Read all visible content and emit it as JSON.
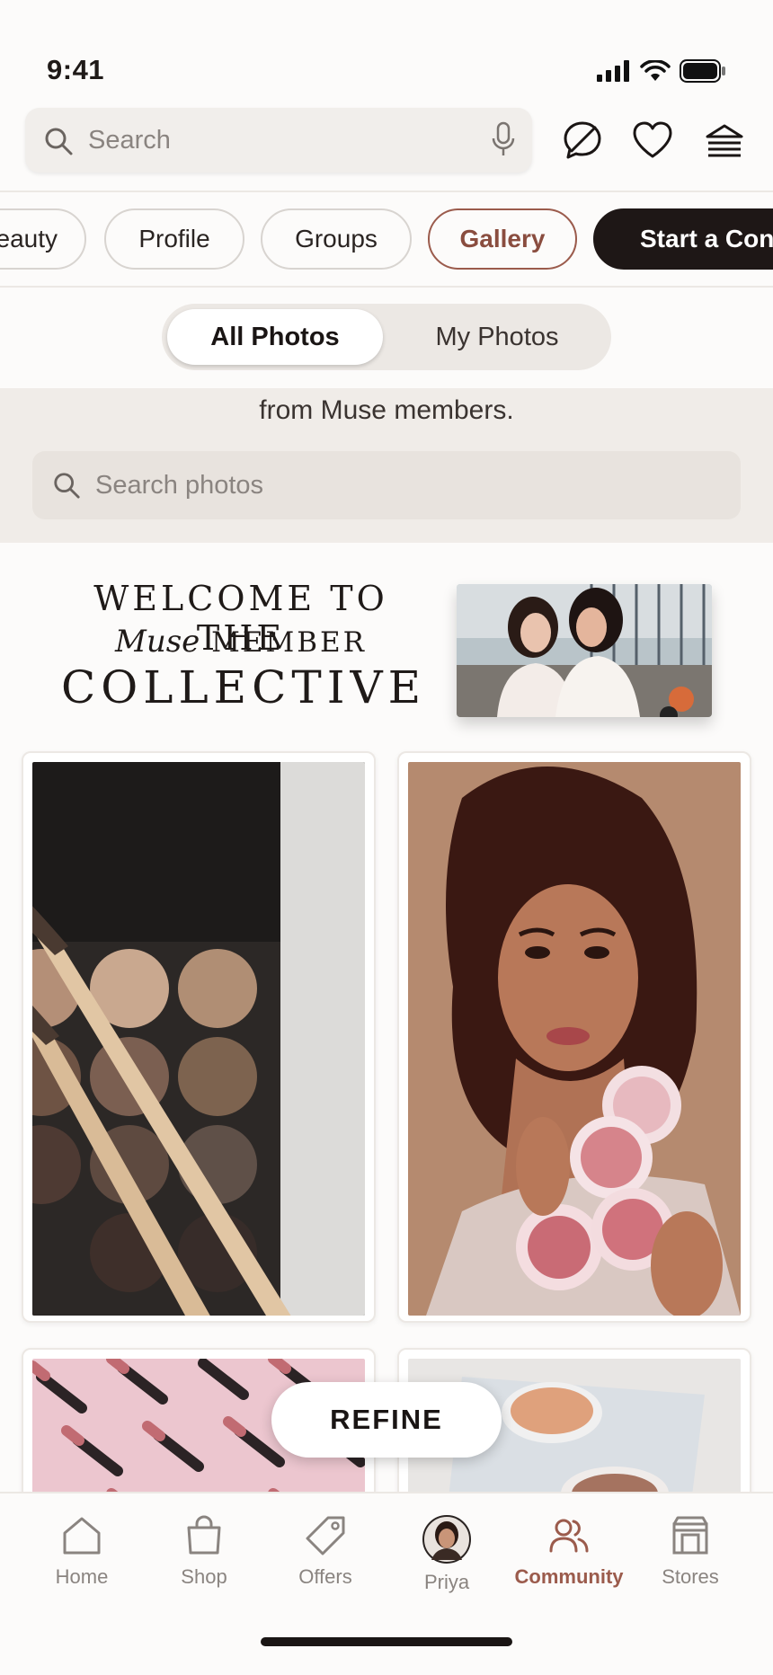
{
  "status": {
    "time": "9:41"
  },
  "header": {
    "search_placeholder": "Search"
  },
  "chips": [
    {
      "label": "eauty"
    },
    {
      "label": "Profile"
    },
    {
      "label": "Groups"
    },
    {
      "label": "Gallery",
      "active": true
    },
    {
      "label": "Start a Con"
    }
  ],
  "segment": {
    "all": "All Photos",
    "mine": "My Photos",
    "selected": "All Photos"
  },
  "band": {
    "description": "from Muse members.",
    "search_placeholder": "Search photos"
  },
  "welcome": {
    "line1": "WELCOME TO THE",
    "line2_script": "Muse",
    "line2_rest": " MEMBER",
    "line3": "COLLECTIVE"
  },
  "photos": [
    {
      "subject": "eyeshadow palette with brushes"
    },
    {
      "subject": "woman holding blush compacts"
    },
    {
      "subject": "lipsticks on pink background"
    },
    {
      "subject": "cream compact on tray"
    }
  ],
  "refine_label": "REFINE",
  "tabs": [
    {
      "label": "Home",
      "icon": "home-icon"
    },
    {
      "label": "Shop",
      "icon": "bag-icon"
    },
    {
      "label": "Offers",
      "icon": "tag-icon"
    },
    {
      "label": "Priya",
      "icon": "avatar"
    },
    {
      "label": "Community",
      "icon": "people-icon",
      "active": true
    },
    {
      "label": "Stores",
      "icon": "store-icon"
    }
  ],
  "colors": {
    "accent": "#9b5b4c",
    "dark": "#1e1716",
    "background": "#fcfbfa",
    "band": "#f0ece8"
  }
}
